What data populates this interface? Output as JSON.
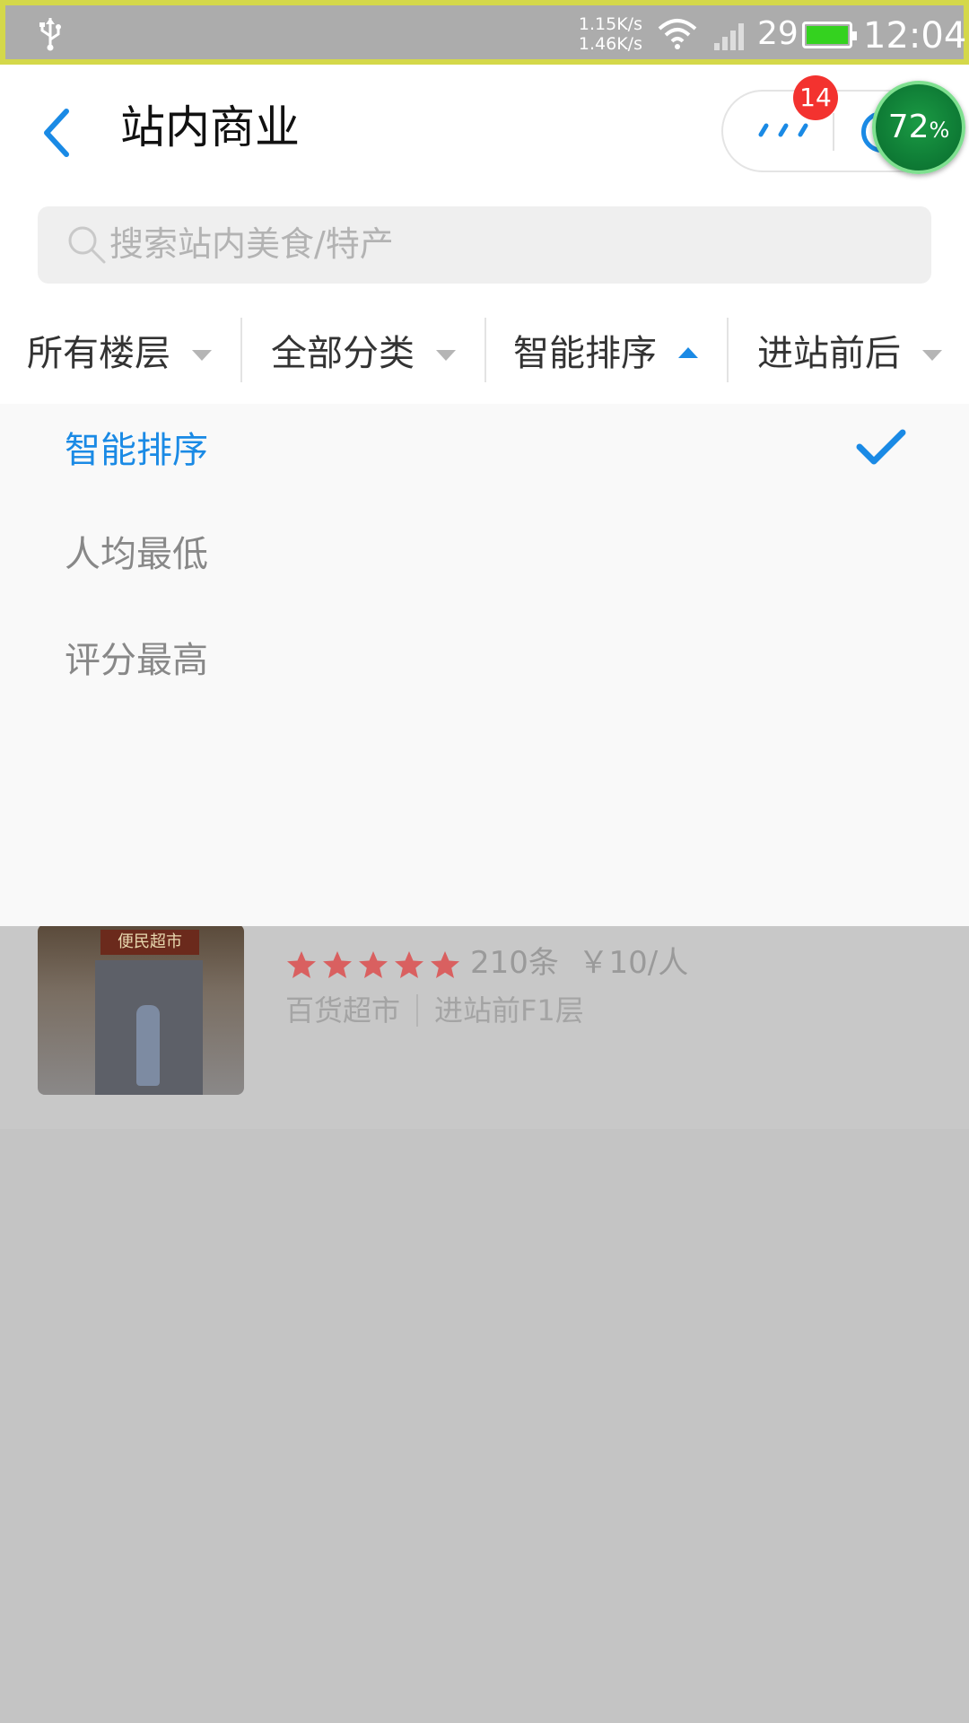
{
  "status_bar": {
    "net_up": "1.15K/s",
    "net_down": "1.46K/s",
    "battery_level": "29",
    "time": "12:04"
  },
  "header": {
    "title": "站内商业",
    "notification_count": "14",
    "boost_percent": "72",
    "boost_unit": "%"
  },
  "search": {
    "placeholder": "搜索站内美食/特产"
  },
  "filters": [
    {
      "label": "所有楼层",
      "active": false
    },
    {
      "label": "全部分类",
      "active": false
    },
    {
      "label": "智能排序",
      "active": true
    },
    {
      "label": "进站前后",
      "active": false
    }
  ],
  "sort_options": [
    {
      "label": "智能排序",
      "selected": true
    },
    {
      "label": "人均最低",
      "selected": false
    },
    {
      "label": "评分最高",
      "selected": false
    }
  ],
  "list_item": {
    "thumb_sign": "便民超市",
    "rating": 5,
    "reviews": "210条",
    "price": "￥10/人",
    "category": "百货超市",
    "location": "进站前F1层"
  },
  "colors": {
    "accent": "#1a8ae5",
    "badge": "#f3322f",
    "star": "#d96060"
  }
}
